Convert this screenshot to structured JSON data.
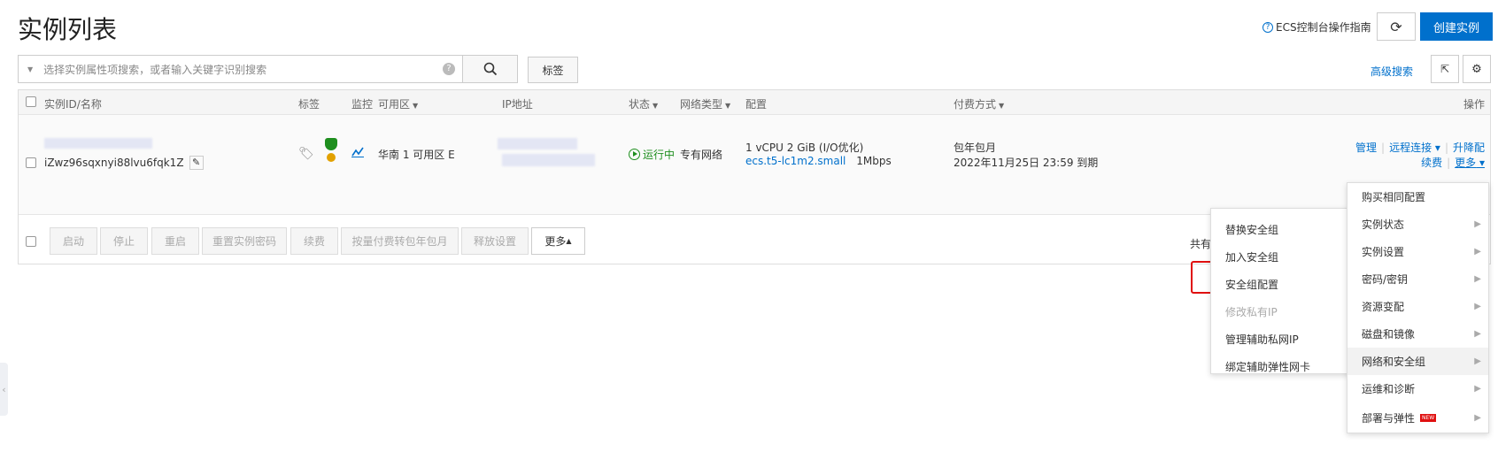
{
  "header": {
    "title": "实例列表",
    "guide_link": "ECS控制台操作指南",
    "create_button": "创建实例"
  },
  "search": {
    "placeholder": "选择实例属性项搜索，或者输入关键字识别搜索",
    "tags_button": "标签",
    "advanced_search": "高级搜索"
  },
  "table": {
    "columns": {
      "id_name": "实例ID/名称",
      "tags": "标签",
      "monitor": "监控",
      "zone": "可用区",
      "ip": "IP地址",
      "status": "状态",
      "network_type": "网络类型",
      "config": "配置",
      "billing": "付费方式",
      "actions": "操作"
    },
    "row": {
      "instance_id": "iZwz96sqxnyi88lvu6fqk1Z",
      "zone": "华南 1 可用区 E",
      "status": "运行中",
      "network_type": "专有网络",
      "config_line1": "1 vCPU 2 GiB (I/O优化)",
      "config_type": "ecs.t5-lc1m2.small",
      "bandwidth": "1Mbps",
      "billing_type": "包年包月",
      "expire": "2022年11月25日 23:59 到期",
      "actions": {
        "manage": "管理",
        "remote": "远程连接",
        "upgrade": "升降配",
        "renew": "续费",
        "more": "更多"
      }
    }
  },
  "footer": {
    "buttons": [
      "启动",
      "停止",
      "重启",
      "重置实例密码",
      "续费",
      "按量付费转包年包月",
      "释放设置"
    ],
    "more": "更多",
    "total_prefix": "共有"
  },
  "submenu": {
    "items": [
      "替换安全组",
      "加入安全组",
      "安全组配置",
      "修改私有IP",
      "管理辅助私网IP",
      "绑定辅助弹性网卡"
    ]
  },
  "mainmenu": {
    "items": [
      "购买相同配置",
      "实例状态",
      "实例设置",
      "密码/密钥",
      "资源变配",
      "磁盘和镜像",
      "网络和安全组",
      "运维和诊断",
      "部署与弹性"
    ],
    "new_badge": "NEW"
  },
  "colors": {
    "accent": "#0070cc",
    "running": "#1e8e1e",
    "highlight": "#e01010"
  }
}
